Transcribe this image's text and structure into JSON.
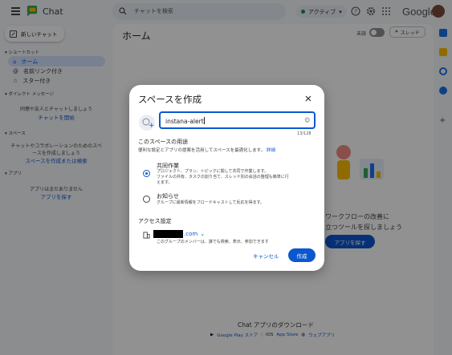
{
  "topbar": {
    "app_name": "Chat",
    "search_placeholder": "チャットを検索",
    "status": "アクティブ",
    "google": "Google"
  },
  "sidebar": {
    "new_chat": "新しいチャット",
    "shortcuts_heading": "ショートカット",
    "items": [
      {
        "label": "ホーム",
        "icon": "home-icon"
      },
      {
        "label": "名前リンク付き",
        "icon": "at-icon"
      },
      {
        "label": "スター付き",
        "icon": "star-icon"
      }
    ],
    "dm_heading": "ダイレクト メッセージ",
    "dm_note": "同僚や友人とチャットしましょう",
    "dm_link": "チャットを開始",
    "spaces_heading": "スペース",
    "spaces_note_1": "チャットやコラボレーションのためのスペ",
    "spaces_note_2": "ースを作成しましょう",
    "spaces_link": "スペースを作成または検索",
    "apps_heading": "アプリ",
    "apps_note": "アプリはまだありません",
    "apps_link": "アプリを探す"
  },
  "main": {
    "title": "ホーム",
    "unread_label": "未読",
    "threads_label": "スレッド",
    "bg_line_1": "ワークフローの改善に",
    "bg_line_2": "立つツールを探しましょう",
    "bg_button": "アプリを探す",
    "download_title": "Chat アプリのダウンロード",
    "google_play": "Google Play ストア",
    "ios": "iOS",
    "app_store": "App Store",
    "web_app": "ウェブアプリ"
  },
  "dialog": {
    "title": "スペースを作成",
    "name_value": "instana-alert",
    "counter": "13/128",
    "purpose_heading": "このスペースの用途",
    "purpose_sub": "便利な設定とアプリの提案を活用してスペースを最適化します。",
    "purpose_link": "詳細",
    "option1_title": "共同作業",
    "option1_desc_1": "プロジェクト、プラン、トピックに関して共同で作業します。",
    "option1_desc_2": "ファイルの共有、タスクの割り当て、スレッド別の会話の整理も簡単に行",
    "option1_desc_3": "えます。",
    "option2_title": "お知らせ",
    "option2_desc": "グループに最新情報をブロードキャストして反応を得ます。",
    "access_heading": "アクセス設定",
    "domain_suffix": ".com",
    "access_desc": "このグループのメンバーは、誰でも検索、表示、参加できます",
    "cancel": "キャンセル",
    "create": "作成"
  },
  "colors": {
    "accent": "#0b57d0",
    "selected_nav": "#d3e3fd"
  }
}
